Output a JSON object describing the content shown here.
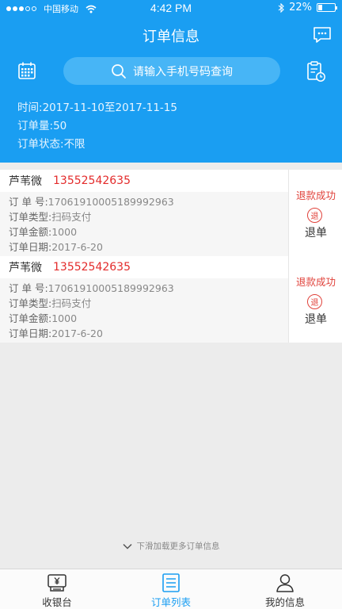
{
  "status_bar": {
    "carrier": "中国移动",
    "time": "4:42 PM",
    "battery": "22%",
    "battery_level": 0.22
  },
  "header": {
    "title": "订单信息",
    "search_placeholder": "请输入手机号码查询",
    "filters": {
      "time_label": "时间:",
      "time_value": "2017-11-10至2017-11-15",
      "count_label": "订单量:",
      "count_value": "50",
      "state_label": "订单状态:",
      "state_value": "不限"
    }
  },
  "field_labels": {
    "order_no": "订 单 号:",
    "order_type": "订单类型:",
    "order_amount": "订单金额:",
    "order_date": "订单日期:"
  },
  "orders": [
    {
      "name": "芦苇微",
      "phone": "13552542635",
      "order_no": "17061910005189992963",
      "order_type": "扫码支付",
      "amount": "1000",
      "date": "2017-6-20",
      "status": "退款成功",
      "stamp": "退",
      "action": "退单"
    },
    {
      "name": "芦苇微",
      "phone": "13552542635",
      "order_no": "17061910005189992963",
      "order_type": "扫码支付",
      "amount": "1000",
      "date": "2017-6-20",
      "status": "退款成功",
      "stamp": "退",
      "action": "退单"
    }
  ],
  "load_more": "下滑加载更多订单信息",
  "tabs": [
    {
      "label": "收银台",
      "icon": "cashier-icon",
      "active": false
    },
    {
      "label": "订单列表",
      "icon": "list-icon",
      "active": true
    },
    {
      "label": "我的信息",
      "icon": "user-icon",
      "active": false
    }
  ],
  "colors": {
    "primary": "#1a9ef2",
    "search_bg": "#47b5f6",
    "phone_red": "#e32b2b",
    "status_red": "#e0413a"
  }
}
